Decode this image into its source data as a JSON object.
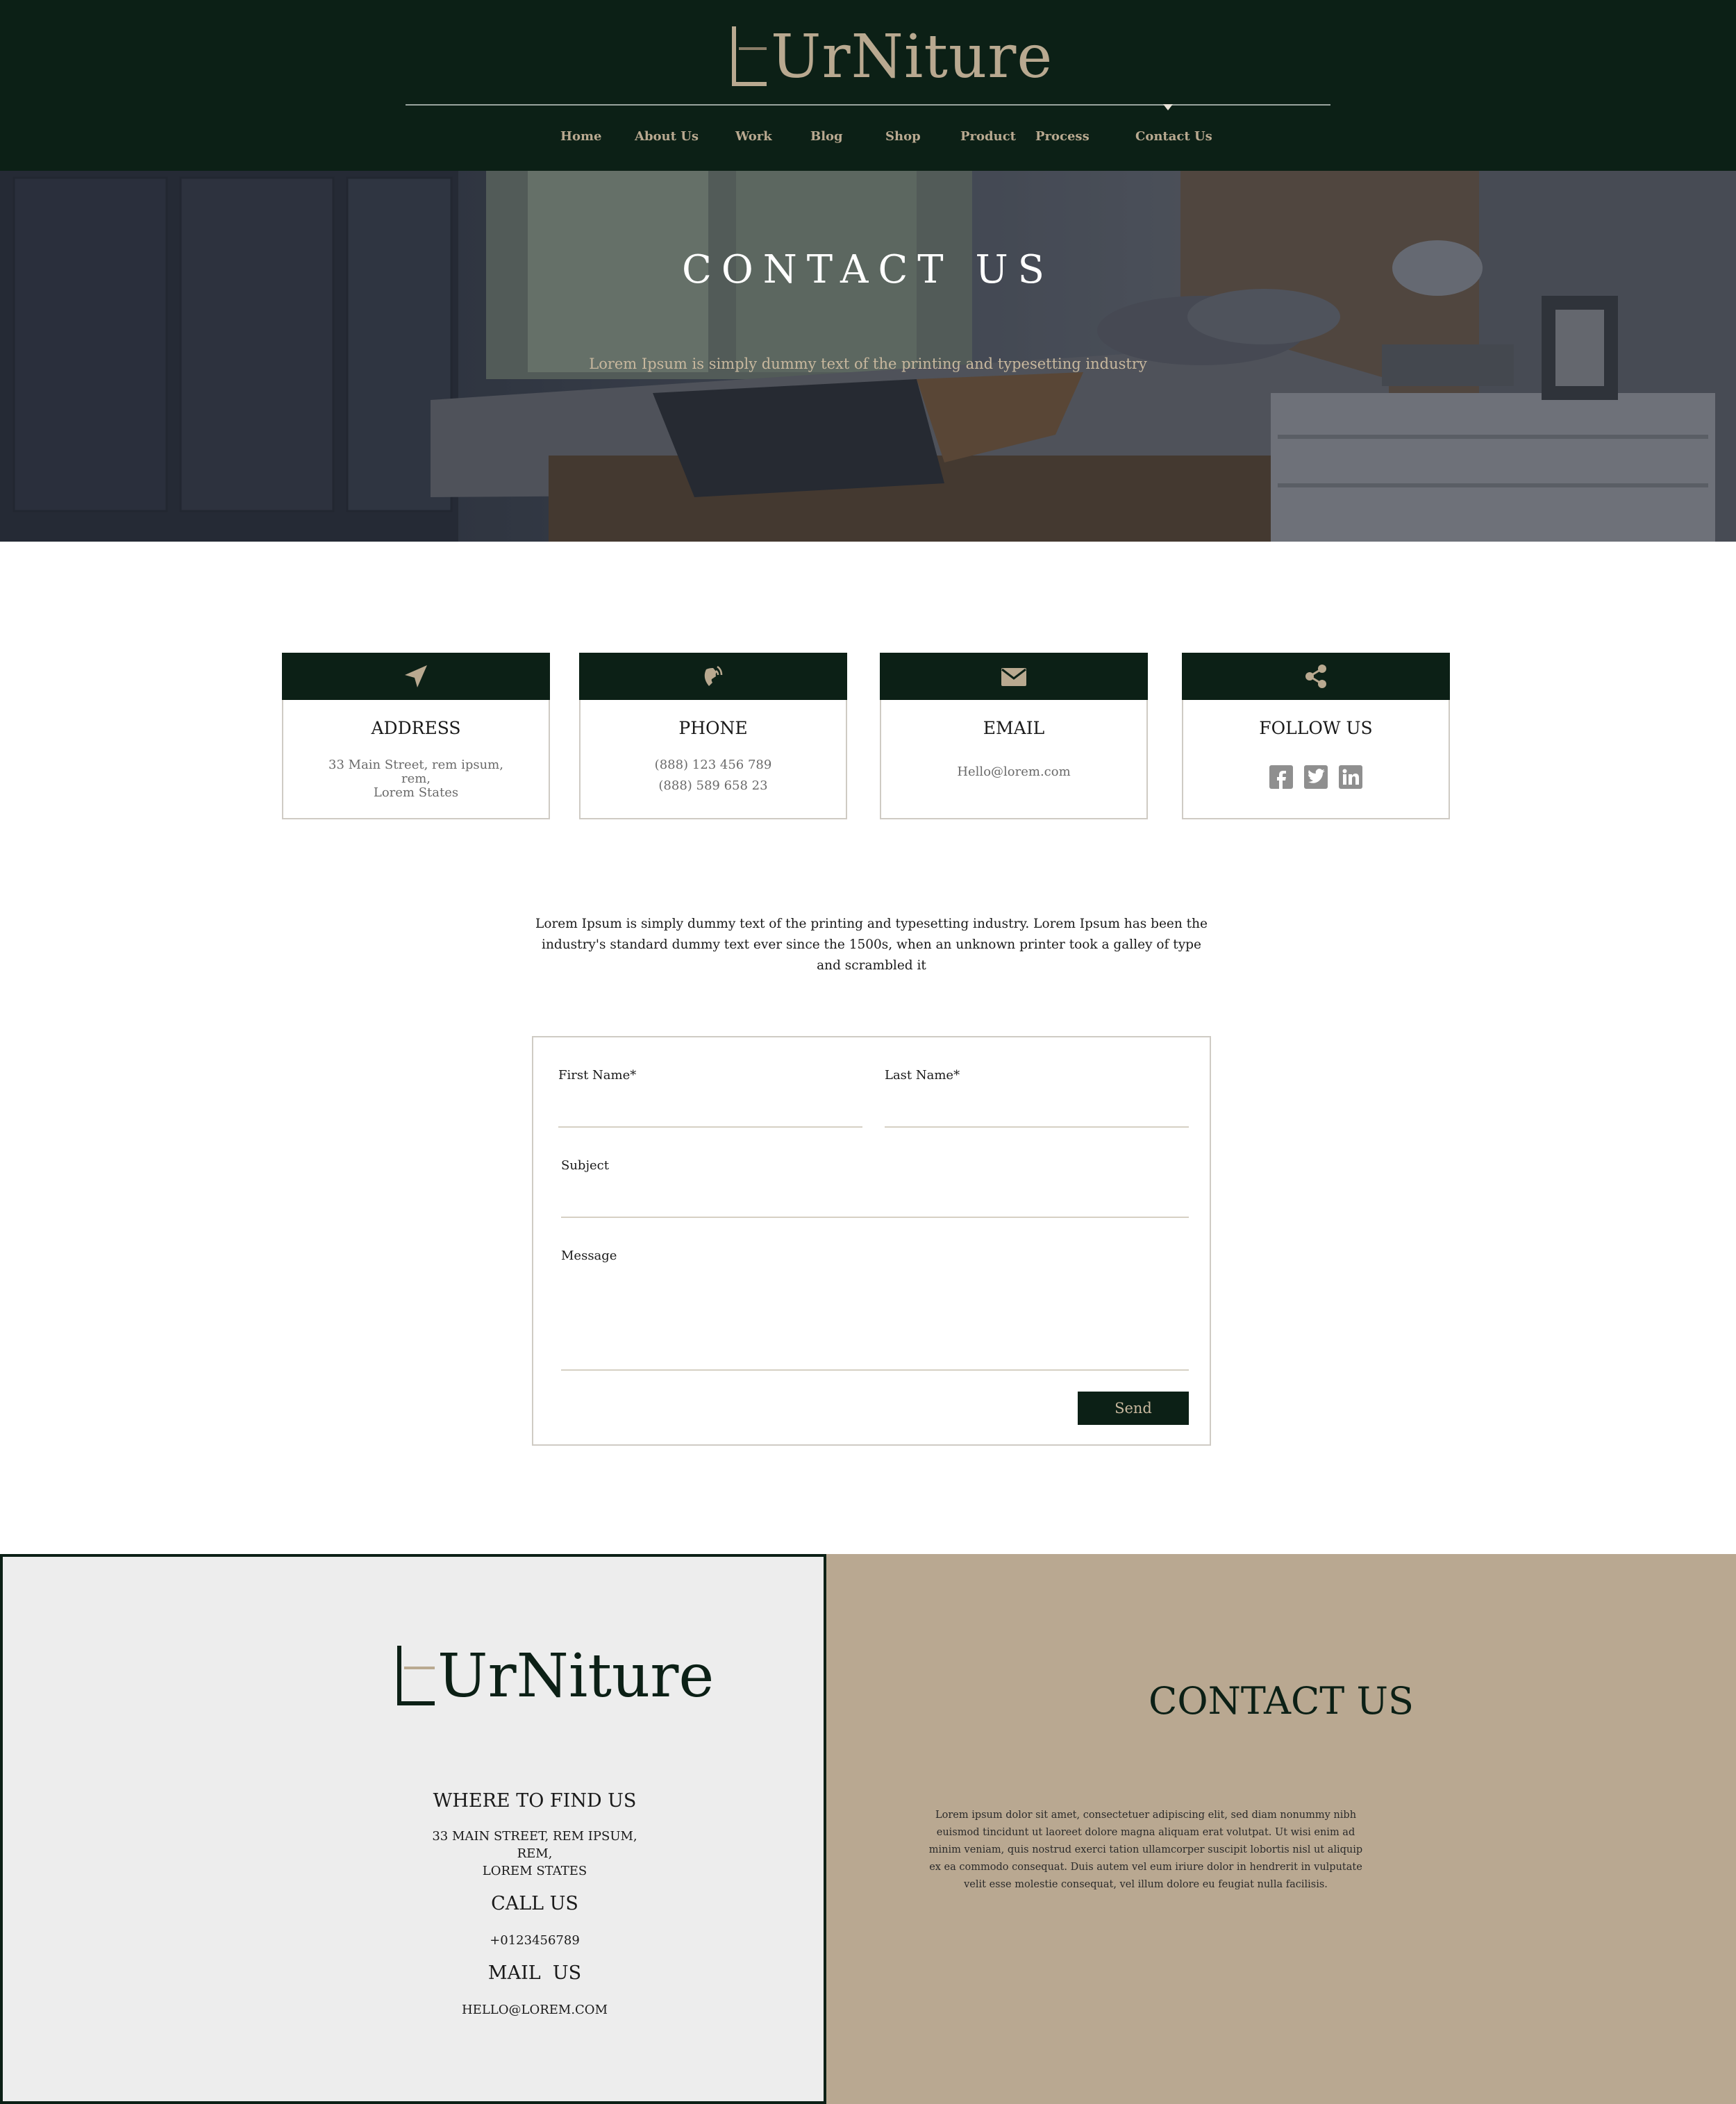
{
  "brand": {
    "logo_text": "UrNiture",
    "logo_text_bottom": "UrNiture"
  },
  "nav": {
    "items": [
      {
        "label": "Home"
      },
      {
        "label": "About Us"
      },
      {
        "label": "Work"
      },
      {
        "label": "Blog"
      },
      {
        "label": "Shop"
      },
      {
        "label": "Product"
      },
      {
        "label": "Process"
      },
      {
        "label": "Contact Us"
      }
    ],
    "active": "Contact Us"
  },
  "hero": {
    "title": "CONTACT US",
    "subtitle": "Lorem Ipsum is simply dummy text of the printing and typesetting industry"
  },
  "cards": [
    {
      "icon": "location-arrow-icon",
      "title": "ADDRESS",
      "lines": [
        "33 Main Street, rem ipsum,",
        "rem,",
        "Lorem States"
      ]
    },
    {
      "icon": "phone-icon",
      "title": "PHONE",
      "lines": [
        "(888) 123 456 789",
        "(888) 589 658 23"
      ]
    },
    {
      "icon": "envelope-icon",
      "title": "EMAIL",
      "lines": [
        "Hello@lorem.com"
      ]
    },
    {
      "icon": "share-icon",
      "title": "FOLLOW US",
      "social": [
        "facebook-icon",
        "twitter-icon",
        "linkedin-icon"
      ]
    }
  ],
  "intro": "Lorem Ipsum is simply dummy text of the printing and typesetting industry. Lorem Ipsum has been the industry's standard dummy text ever since the 1500s, when an unknown printer took a galley of type and scrambled it",
  "form": {
    "first_name_label": "First Name*",
    "last_name_label": "Last Name*",
    "subject_label": "Subject",
    "message_label": "Message",
    "send_label": "Send"
  },
  "footer_left": {
    "where_title": "WHERE TO FIND US",
    "address_lines": [
      "33 MAIN STREET, REM IPSUM,",
      "REM,",
      "LOREM STATES"
    ],
    "call_title": "CALL US",
    "phone": "+0123456789",
    "mail_title": "MAIL  US",
    "email": "HELLO@LOREM.COM"
  },
  "footer_right": {
    "title": "CONTACT US",
    "text": "Lorem ipsum dolor sit amet, consectetuer adipiscing elit, sed diam nonummy nibh euismod tincidunt ut laoreet dolore magna aliquam erat volutpat. Ut wisi enim ad minim veniam, quis nostrud exerci tation ullamcorper suscipit lobortis nisl ut aliquip ex ea commodo consequat. Duis autem vel eum iriure dolor in hendrerit in vulputate velit esse molestie consequat, vel illum dolore eu feugiat nulla facilisis."
  },
  "colors": {
    "dark_green": "#0c2016",
    "beige": "#b9a990",
    "tan_panel": "#b9a891",
    "light_gray": "#ededed"
  }
}
